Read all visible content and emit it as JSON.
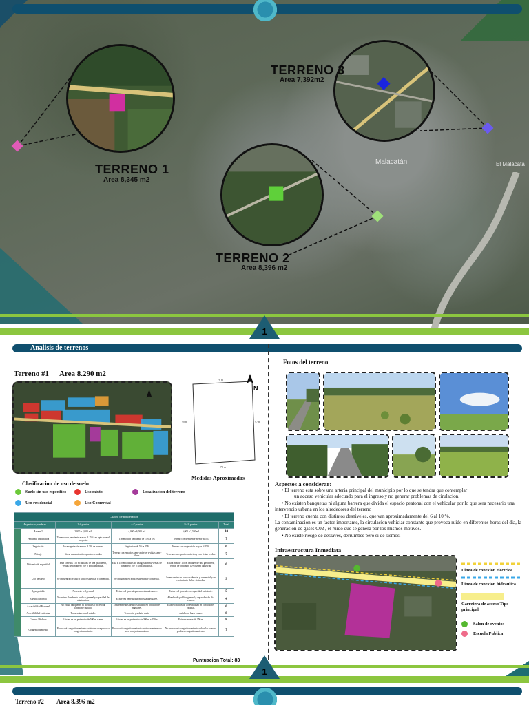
{
  "map": {
    "terreno1": {
      "label": "TERRENO 1",
      "area": "Area 8,345 m2"
    },
    "terreno2": {
      "label": "TERRENO 2",
      "area": "Area 8,396 m2"
    },
    "terreno3": {
      "label": "TERRENO 3",
      "area": "Area 7,392m2"
    },
    "place1": "Malacatán",
    "place2": "El Malacata"
  },
  "page": {
    "number_top": "1",
    "number_bottom": "1"
  },
  "section_title": "Analisis de terrenos",
  "terreno1": {
    "title": "Terreno #1",
    "area": "Area 8.290 m2"
  },
  "drawing": {
    "top": "76 m",
    "left": "90 m",
    "right": "97 m",
    "bottom": "78 m",
    "caption": "Medidas Aproximadas"
  },
  "clasificacion": {
    "title": "Clasificacion de uso de suelo",
    "items": [
      {
        "label": "Suelo sin uso especifico",
        "color": "#6cc93a"
      },
      {
        "label": "Uso  mixto",
        "color": "#e8342f"
      },
      {
        "label": "Localizacion del terreno",
        "color": "#a43a9a"
      },
      {
        "label": "Uso residencial",
        "color": "#3aa8e8"
      },
      {
        "label": "Uso Comercial",
        "color": "#f5a63a"
      }
    ]
  },
  "tabla": {
    "caption": "Cuadro de ponderacion",
    "headers": [
      "Aspectos a ponderar",
      "1-4 puntos",
      "4-7 puntos",
      "8-10 puntos",
      "Total"
    ],
    "rows": [
      {
        "aspect": "Area m2",
        "c1": "2,000 a 4,000 m2",
        "c2": "4,000 a 6,000 m2",
        "c3": "6,000 a 7,500m2",
        "total": "10"
      },
      {
        "aspect": "Pendiente topografica",
        "c1": "Terreno con pendiente mayor al 15%, no apto para el proyecto.",
        "c2": "Terreno con pendiente de 15% a 5%",
        "c3": "Terreno con pendiente menor al 5%",
        "total": "7"
      },
      {
        "aspect": "Vegetación",
        "c1": "Poca vegetación menor al 5% de terreno.",
        "c2": "Vegetación de 5% a 25%",
        "c3": "Terreno con vegetación mayor al 25%.",
        "total": "6"
      },
      {
        "aspect": "Paisaje",
        "c1": "No se encuentrarán espacios cerrados",
        "c2": "Terreno con espacios semi-abiertos y vistas semi-libres.",
        "c3": "Terreno con espacios abiertos y con vistas verdes.",
        "total": "7"
      },
      {
        "aspect": "Distancia de seguridad",
        "c1": "Esta a menos 150 m radiales de una gasolinera, ventas de fontanero 10+ o zona industrial.",
        "c2": "Esta a 150 m radiales de una gasolinera, ventas de fontanero 10+ o zona industrial.",
        "c3": "Esta a mas de 150 m radiales de una gasolinera, ventas de fontanero 10+ o zona industrial.",
        "total": "6"
      },
      {
        "aspect": "Uso de suelo",
        "c1": "Se encuentra cercano a zona residencial y comercial.",
        "c2": "Se encuentra en zona residencial y comercial.",
        "c3": "Se encuentra en zona residencial y comercial y en crecimiento de las viviendas.",
        "total": "9"
      },
      {
        "aspect": "Agua potable",
        "c1": "No existe red general",
        "c2": "Existe red general que necesita adecuarse.",
        "c3": "Existe red general con capacidad suficiente.",
        "total": "5"
      },
      {
        "aspect": "Energia electrica",
        "c1": "No existe alumbrado publico general y capacidad de alta tension.",
        "c2": "Existe red general que necesita adecuarse.",
        "c3": "Alumbrado publico general y capacidad de alta tension.",
        "total": "4"
      },
      {
        "aspect": "Accesibilidad Peatonal",
        "c1": "No existe banquetas, ni bordillos o acceso de transporte publico.",
        "c2": "Existen medios de accesibilidad en condiciones regulares.",
        "c3": "Existen medios de accesibilidad en condiciones optimas.",
        "total": "6"
      },
      {
        "aspect": "Accesibilidad vehicular",
        "c1": "Terraceria en mal estado.",
        "c2": "Terraceria y asfalto malo.",
        "c3": "Asfalto en buen estado.",
        "total": "8"
      },
      {
        "aspect": "Centros Medicos",
        "c1": "Existen en un perimetro de 500 m o mas.",
        "c2": "Existen en un perimetro de 200 m a 250m.",
        "c3": "Existe a menos de 150 m",
        "total": "8"
      },
      {
        "aspect": "Congestionamiento",
        "c1": "Provocará congestionamiento vehicular o se provoca congestionamiento.",
        "c2": "Provocará congestionamiento vehicular minimo o poco congestionamiento.",
        "c3": "No provocará congestionamiento vehicular (o no se produce congestionamiento.",
        "total": "7"
      }
    ],
    "total": "Puntuacion Total: 83"
  },
  "fotos_title": "Fotos del terreno",
  "aspectos": {
    "title": "Aspectos a considerar:",
    "lines": [
      "• El terreno esta sobre una arteria principal del municipio por lo que se tendra que contemplar",
      "un acceso vehicular adecuado para el ingreso y no generar problemas de cirulacion.",
      "• No existen banquetas ni alguna barrera que divida el espacio peatonal con el vehicular por lo que sera necesario una intervencio urbana en los alrededores del terreno",
      "• El terreno cuenta con distintos desniveles, que van aproximadamente del 6 al 10 %.",
      "La contaminacion es un factor importante, la circulacion vehiclar constante que provoca ruido en diferentes horas del dia, la generacion de gases C02 , el ruido que se genera por los mismos motivos.",
      "• No existe riesgo de deslaves, derrumbes pero si de sismos."
    ]
  },
  "infra": {
    "title": "Infraestructura Inmediata",
    "legend": [
      {
        "label": "Linea de conexion electrica",
        "color": "#f2d23a"
      },
      {
        "label": "Linea de conexion hidraulica",
        "color": "#3aa8e8"
      },
      {
        "label": "Carretera de acceso Tipo  principal",
        "color": "#f7ee8c"
      },
      {
        "label": "Salon de eventos",
        "color": "#55b82f"
      },
      {
        "label": "Escuela Publica",
        "color": "#ef6b8a"
      }
    ]
  },
  "terreno2": {
    "title": "Terreno #2",
    "area": "Area 8.396 m2"
  }
}
